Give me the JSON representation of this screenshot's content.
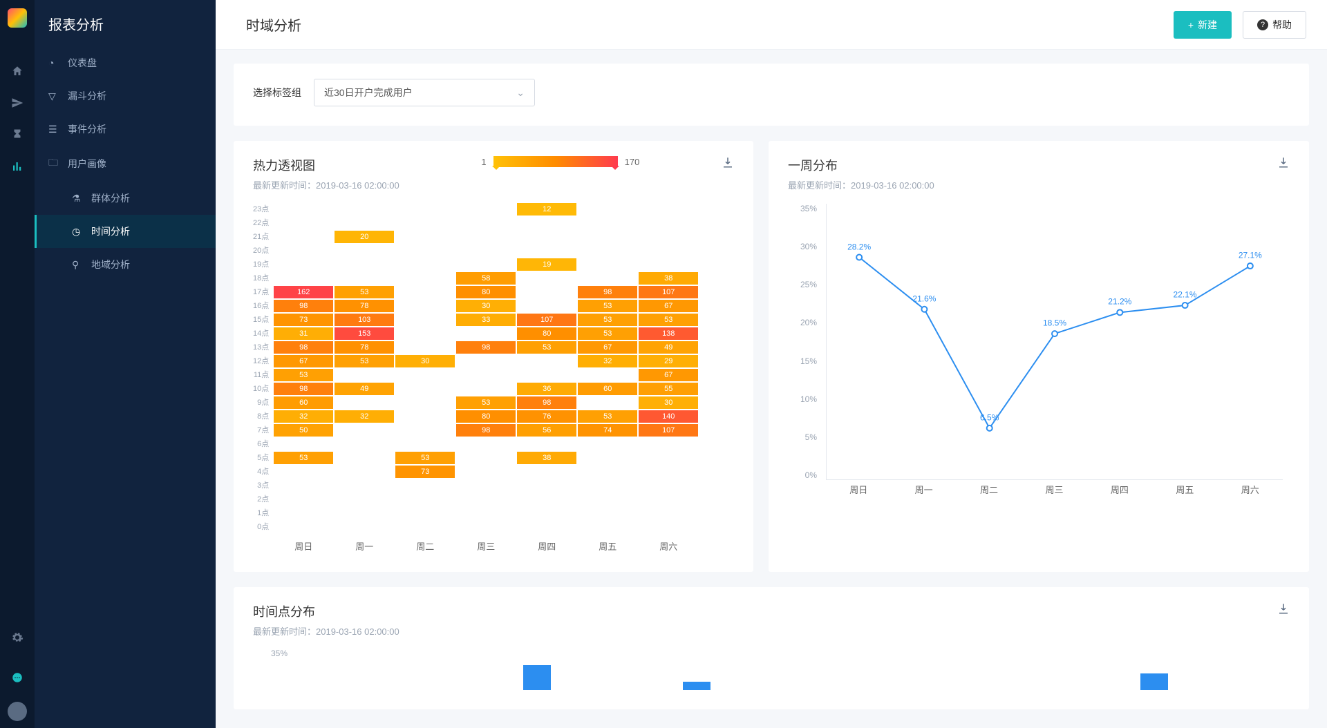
{
  "sidebar": {
    "app_title": "报表分析",
    "items": [
      {
        "label": "仪表盘",
        "icon": "gauge"
      },
      {
        "label": "漏斗分析",
        "icon": "funnel"
      },
      {
        "label": "事件分析",
        "icon": "event"
      },
      {
        "label": "用户画像",
        "icon": "folder"
      }
    ],
    "subitems": [
      {
        "label": "群体分析",
        "icon": "users"
      },
      {
        "label": "时间分析",
        "icon": "clock",
        "active": true
      },
      {
        "label": "地域分析",
        "icon": "map"
      }
    ]
  },
  "topbar": {
    "title": "时域分析",
    "new_label": "新建",
    "help_label": "帮助"
  },
  "filter": {
    "label": "选择标签组",
    "selected": "近30日开户完成用户"
  },
  "heatmap": {
    "title": "热力透视图",
    "subtitle_prefix": "最新更新时间：",
    "subtitle_time": "2019-03-16 02:00:00",
    "legend_min": "1",
    "legend_max": "170"
  },
  "week_dist": {
    "title": "一周分布",
    "subtitle_prefix": "最新更新时间：",
    "subtitle_time": "2019-03-16 02:00:00"
  },
  "time_point": {
    "title": "时间点分布",
    "subtitle_prefix": "最新更新时间：",
    "subtitle_time": "2019-03-16 02:00:00",
    "ytick": "35%"
  },
  "chart_data": [
    {
      "type": "heatmap",
      "name": "heatmap",
      "title": "热力透视图",
      "x_categories": [
        "周日",
        "周一",
        "周二",
        "周三",
        "周四",
        "周五",
        "周六"
      ],
      "y_categories": [
        "23点",
        "22点",
        "21点",
        "20点",
        "19点",
        "18点",
        "17点",
        "16点",
        "15点",
        "14点",
        "13点",
        "12点",
        "11点",
        "10点",
        "9点",
        "8点",
        "7点",
        "6点",
        "5点",
        "4点",
        "3点",
        "2点",
        "1点",
        "0点"
      ],
      "grid": [
        [
          null,
          null,
          null,
          null,
          12,
          null,
          null
        ],
        [
          null,
          null,
          null,
          null,
          null,
          null,
          null
        ],
        [
          null,
          20,
          null,
          null,
          null,
          null,
          null
        ],
        [
          null,
          null,
          null,
          null,
          null,
          null,
          null
        ],
        [
          null,
          null,
          null,
          null,
          19,
          null,
          null
        ],
        [
          null,
          null,
          null,
          58,
          null,
          null,
          38
        ],
        [
          162,
          53,
          null,
          80,
          null,
          98,
          107
        ],
        [
          98,
          78,
          null,
          30,
          null,
          53,
          67
        ],
        [
          73,
          103,
          null,
          33,
          107,
          53,
          53
        ],
        [
          31,
          153,
          null,
          null,
          80,
          53,
          138
        ],
        [
          98,
          78,
          null,
          98,
          53,
          67,
          49
        ],
        [
          67,
          53,
          30,
          null,
          null,
          32,
          29
        ],
        [
          53,
          null,
          null,
          null,
          null,
          null,
          67
        ],
        [
          98,
          49,
          null,
          null,
          36,
          60,
          55
        ],
        [
          60,
          null,
          null,
          53,
          98,
          null,
          30
        ],
        [
          32,
          32,
          null,
          80,
          76,
          53,
          140
        ],
        [
          50,
          null,
          null,
          98,
          56,
          74,
          107
        ],
        [
          null,
          null,
          null,
          null,
          null,
          null,
          null
        ],
        [
          53,
          null,
          53,
          null,
          38,
          null,
          null
        ],
        [
          null,
          null,
          73,
          null,
          null,
          null,
          null
        ],
        [
          null,
          null,
          null,
          null,
          null,
          null,
          null
        ],
        [
          null,
          null,
          null,
          null,
          null,
          null,
          null
        ],
        [
          null,
          null,
          null,
          null,
          null,
          null,
          null
        ],
        [
          null,
          null,
          null,
          null,
          null,
          null,
          null
        ]
      ],
      "color_min": "#ffc107",
      "color_max": "#ff3b4e",
      "vmin": 1,
      "vmax": 170
    },
    {
      "type": "line",
      "name": "week_distribution",
      "title": "一周分布",
      "categories": [
        "周日",
        "周一",
        "周二",
        "周三",
        "周四",
        "周五",
        "周六"
      ],
      "values": [
        28.2,
        21.6,
        6.5,
        18.5,
        21.2,
        22.1,
        27.1
      ],
      "ylabel": "%",
      "ylim": [
        0,
        35
      ],
      "yticks": [
        0,
        5,
        10,
        15,
        20,
        25,
        30,
        35
      ]
    },
    {
      "type": "bar",
      "name": "time_point_distribution_partial",
      "title": "时间点分布",
      "visible_partial": true,
      "ylim": [
        0,
        35
      ]
    }
  ]
}
